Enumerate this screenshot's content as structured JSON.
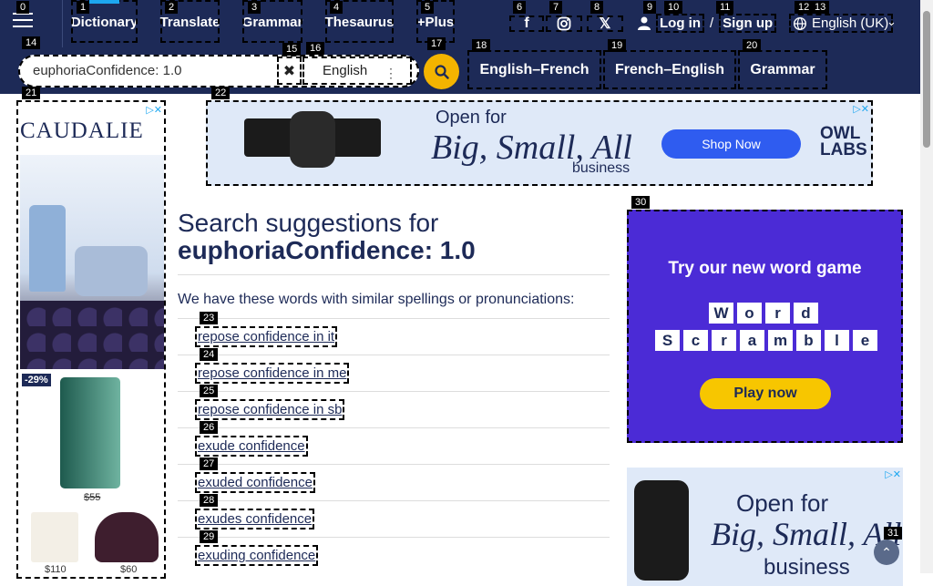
{
  "header": {
    "menu_icon": "hamburger-icon",
    "nav": [
      {
        "label": "Dictionary",
        "active": true
      },
      {
        "label": "Translate"
      },
      {
        "label": "Grammar"
      },
      {
        "label": "Thesaurus"
      },
      {
        "label": "+Plus"
      }
    ],
    "social": [
      "facebook-icon",
      "instagram-icon",
      "x-icon"
    ],
    "login_label": "Log in",
    "login_sep": "/",
    "signup_label": "Sign up",
    "language": "English (UK)"
  },
  "search": {
    "value": "euphoriaConfidence: 1.0",
    "dictionary": "English",
    "links": [
      "English–French",
      "French–English",
      "Grammar"
    ]
  },
  "badges": [
    "0",
    "1",
    "2",
    "3",
    "4",
    "5",
    "6",
    "7",
    "8",
    "9",
    "10",
    "11",
    "12",
    "13",
    "14",
    "15",
    "16",
    "17",
    "18",
    "19",
    "20",
    "21",
    "22",
    "23",
    "24",
    "25",
    "26",
    "27",
    "28",
    "29",
    "30",
    "31"
  ],
  "main": {
    "heading_prefix": "Search suggestions for",
    "heading_term": "euphoriaConfidence: 1.0",
    "intro": "We have these words with similar spellings or pronunciations:",
    "suggestions": [
      "repose confidence in it",
      "repose confidence in me",
      "repose confidence in sb",
      "exude confidence",
      "exuded confidence",
      "exudes confidence",
      "exuding confidence"
    ]
  },
  "ads": {
    "left": {
      "brand": "CAUDALIE",
      "discount": "-29%",
      "price1": "$55",
      "price2": "$110",
      "price3": "$60"
    },
    "banner": {
      "line1": "Open for",
      "line2": "Big, Small, All",
      "line3": "business",
      "cta": "Shop Now",
      "brand": "OWL LABS"
    },
    "right1": {
      "title": "Try our new word game",
      "word1": [
        "W",
        "o",
        "r",
        "d"
      ],
      "word2": [
        "S",
        "c",
        "r",
        "a",
        "m",
        "b",
        "l",
        "e"
      ],
      "cta": "Play now"
    },
    "right2": {
      "line1": "Open for",
      "line2": "Big, Small, All",
      "line3": "business"
    }
  },
  "colors": {
    "navy": "#1d2a57",
    "accent": "#1da7f0",
    "search_btn": "#f4b400",
    "game_bg": "#4b2bd6",
    "game_btn": "#f7c600"
  }
}
